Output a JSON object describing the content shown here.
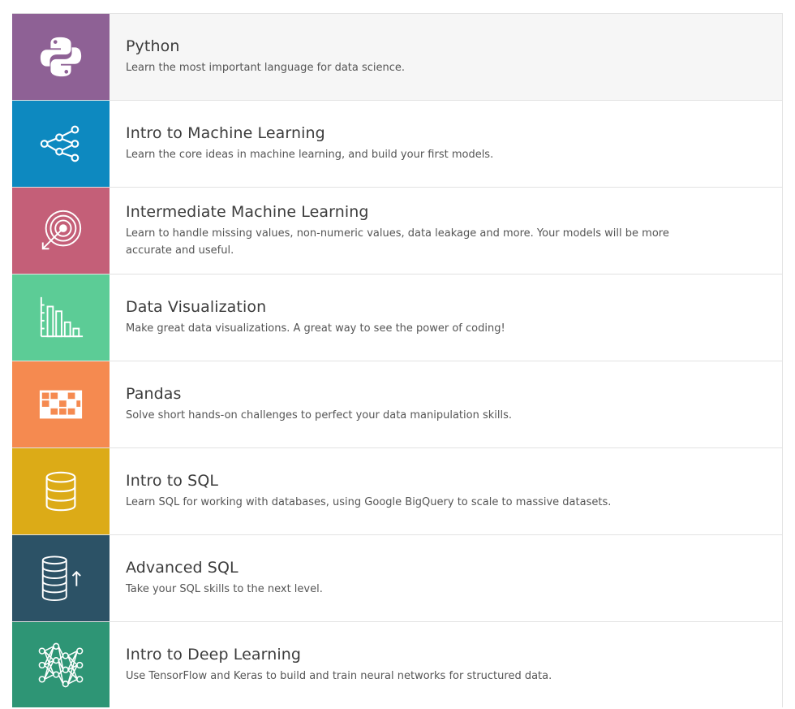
{
  "courses": [
    {
      "title": "Python",
      "description": "Learn the most important language for data science.",
      "icon": "python-logo-icon",
      "color": "#8e6195"
    },
    {
      "title": "Intro to Machine Learning",
      "description": "Learn the core ideas in machine learning, and build your first models.",
      "icon": "network-nodes-icon",
      "color": "#0d89c0"
    },
    {
      "title": "Intermediate Machine Learning",
      "description": "Learn to handle missing values, non-numeric values, data leakage and more. Your models will be more accurate and useful.",
      "icon": "target-arrow-icon",
      "color": "#c45f78"
    },
    {
      "title": "Data Visualization",
      "description": "Make great data visualizations. A great way to see the power of coding!",
      "icon": "bar-chart-icon",
      "color": "#5ccc96"
    },
    {
      "title": "Pandas",
      "description": "Solve short hands-on challenges to perfect your data manipulation skills.",
      "icon": "grid-table-icon",
      "color": "#f58a50"
    },
    {
      "title": "Intro to SQL",
      "description": "Learn SQL for working with databases, using Google BigQuery to scale to massive datasets.",
      "icon": "database-icon",
      "color": "#dcab17"
    },
    {
      "title": "Advanced SQL",
      "description": "Take your SQL skills to the next level.",
      "icon": "database-arrow-up-icon",
      "color": "#2c5266"
    },
    {
      "title": "Intro to Deep Learning",
      "description": "Use TensorFlow and Keras to build and train neural networks for structured data.",
      "icon": "neural-network-icon",
      "color": "#2e9575"
    }
  ]
}
